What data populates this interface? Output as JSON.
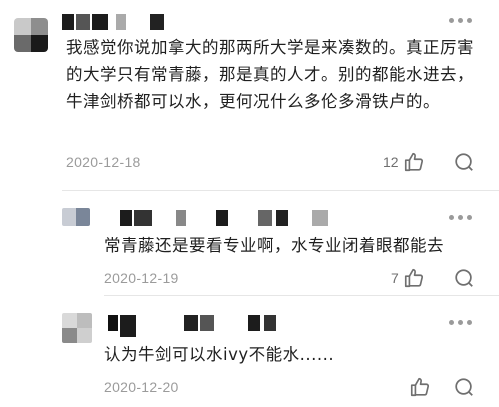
{
  "comments": [
    {
      "text": "我感觉你说加拿大的那两所大学是来凑数的。真正厉害的大学只有常青藤，那是真的人才。别的都能水进去，牛津剑桥都可以水，更何况什么多伦多滑铁卢的。",
      "date": "2020-12-18",
      "likes": "12"
    },
    {
      "text": "常青藤还是要看专业啊，水专业闭着眼都能去",
      "date": "2020-12-19",
      "likes": "7"
    },
    {
      "text": "认为牛剑可以水ivy不能水......",
      "date": "2020-12-20",
      "likes": ""
    }
  ],
  "icons": {
    "like": "thumbs-up-icon",
    "reply": "comment-bubble-icon",
    "more": "more-dots-icon"
  }
}
